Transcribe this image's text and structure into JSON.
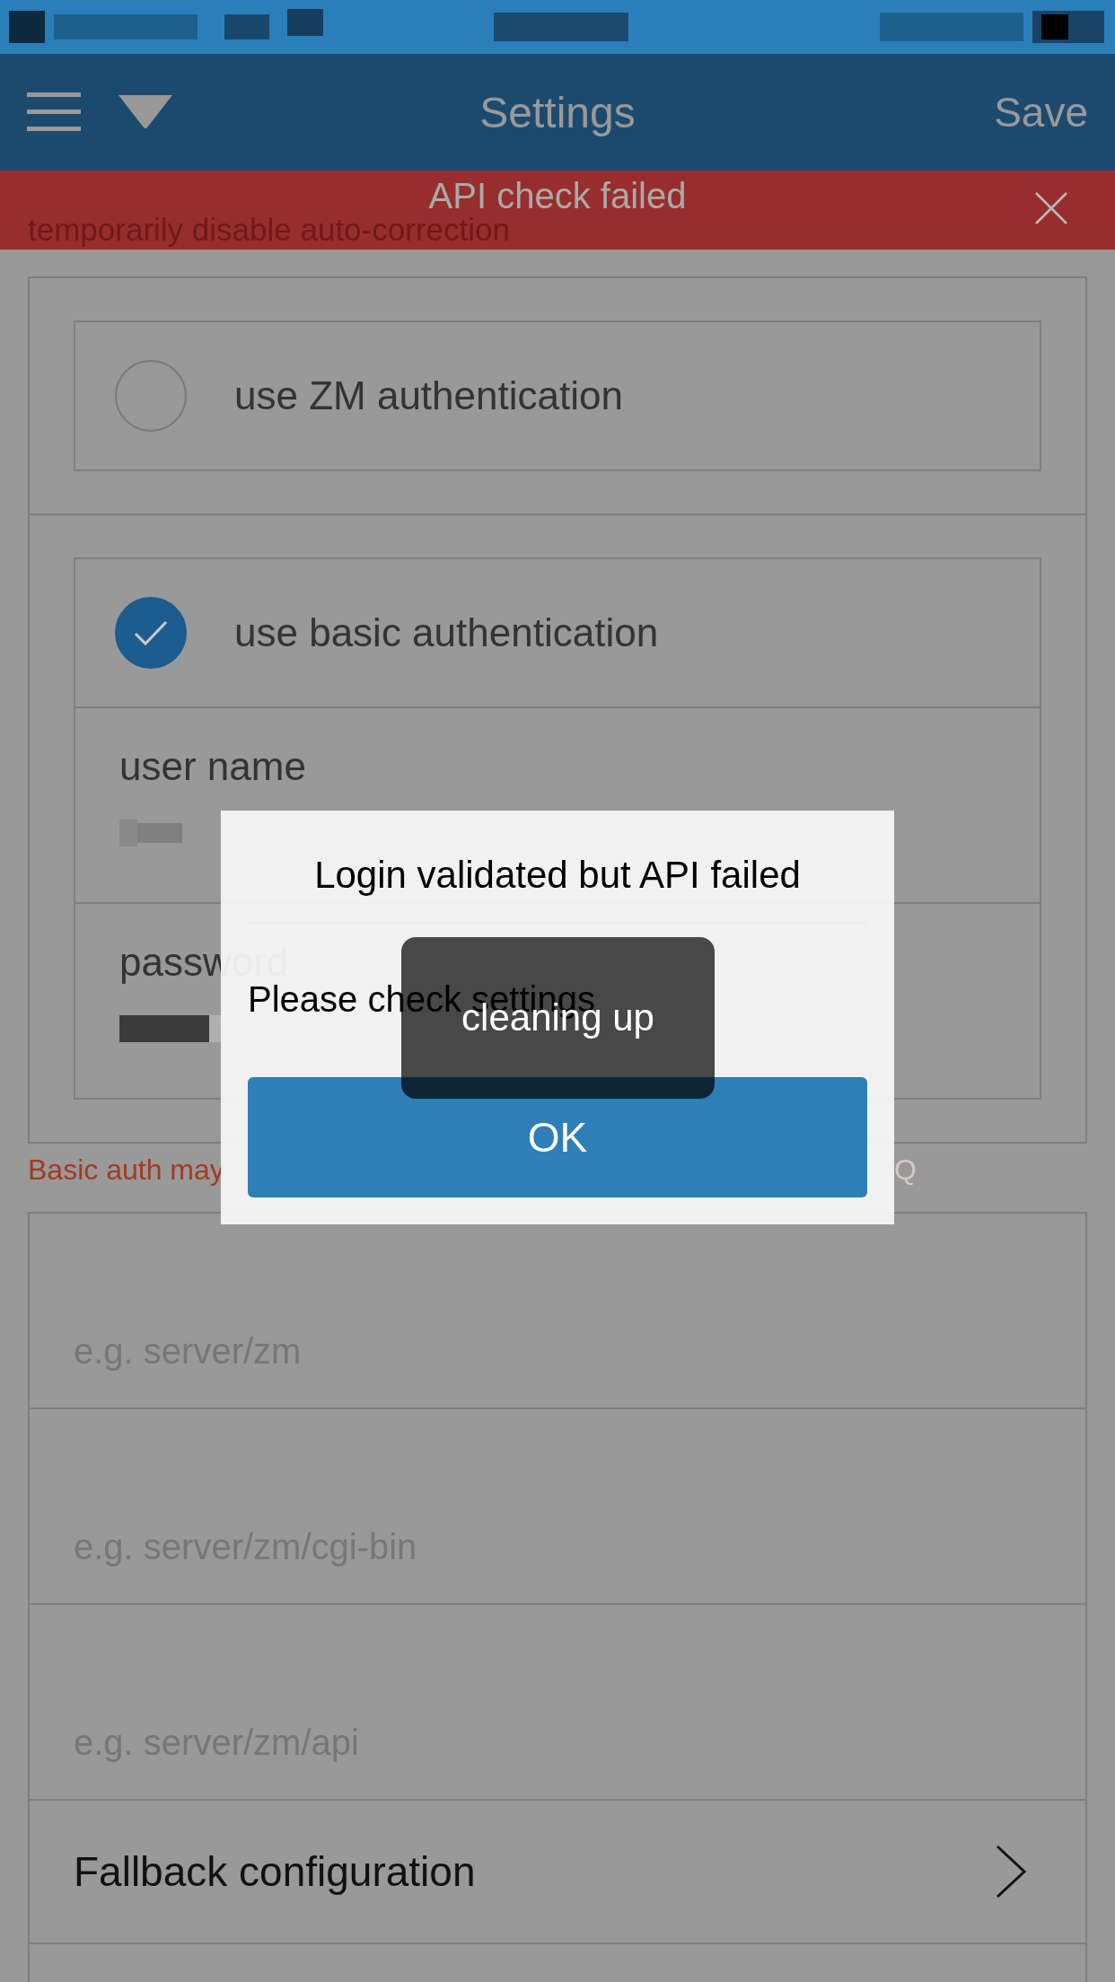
{
  "header": {
    "title": "Settings",
    "action": "Save"
  },
  "banner": {
    "message": "API check failed"
  },
  "notice": "temporarily disable auto-correction",
  "auth_options": [
    {
      "label": "use ZM authentication",
      "selected": false
    },
    {
      "label": "use basic authentication",
      "selected": true,
      "fields": [
        {
          "label": "user name"
        },
        {
          "label": "password"
        }
      ]
    }
  ],
  "hint": {
    "text": "Basic auth may",
    "tail": "Q"
  },
  "url_fields": [
    {
      "placeholder": "e.g. server/zm"
    },
    {
      "placeholder": "e.g. server/zm/cgi-bin"
    },
    {
      "placeholder": "e.g. server/zm/api"
    }
  ],
  "menu": [
    {
      "label": "Fallback configuration"
    }
  ],
  "dialog": {
    "title": "Login validated but API failed",
    "message": "Please check settings",
    "button": "OK"
  },
  "toast": "cleaning up"
}
